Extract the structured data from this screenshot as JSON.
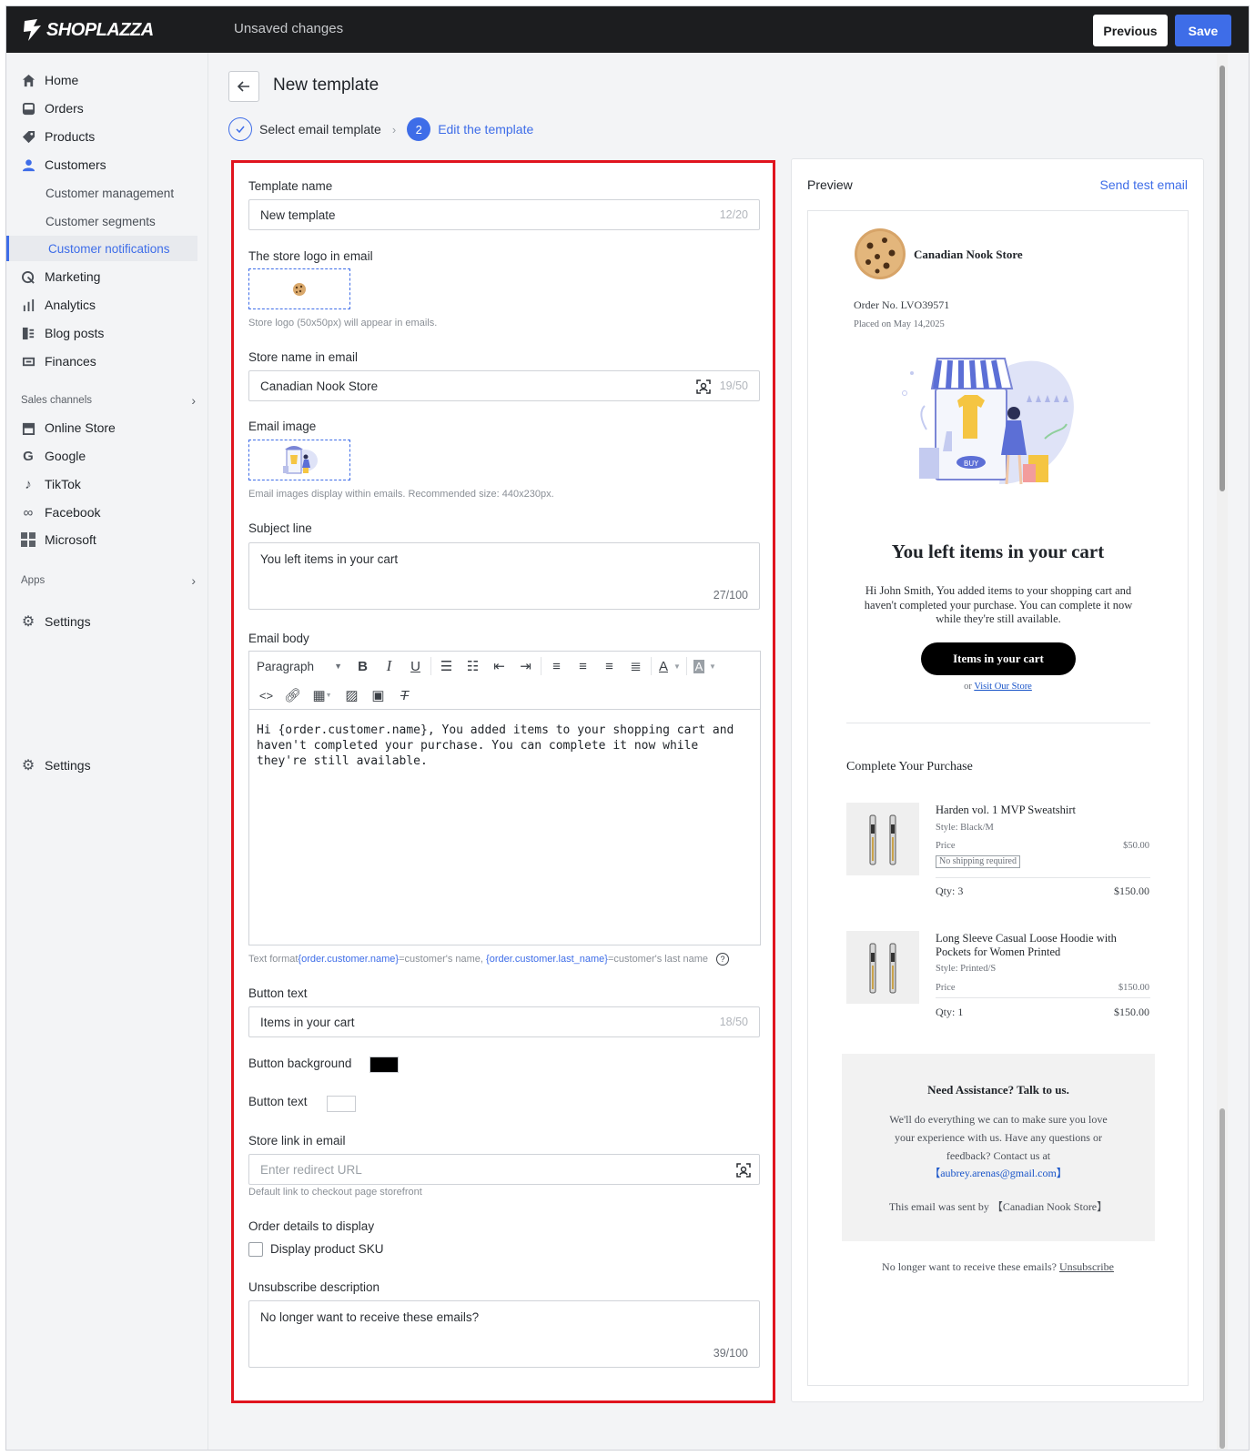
{
  "app": {
    "logo_text": "SHOPLAZZA",
    "status": "Unsaved changes",
    "previous_label": "Previous",
    "save_label": "Save"
  },
  "sidebar": {
    "items": [
      {
        "label": "Home",
        "icon": "home-icon"
      },
      {
        "label": "Orders",
        "icon": "orders-icon"
      },
      {
        "label": "Products",
        "icon": "tag-icon"
      },
      {
        "label": "Customers",
        "icon": "person-icon"
      }
    ],
    "customer_sub": [
      "Customer management",
      "Customer segments",
      "Customer notifications"
    ],
    "items2": [
      {
        "label": "Marketing",
        "icon": "marketing-icon"
      },
      {
        "label": "Analytics",
        "icon": "analytics-icon"
      },
      {
        "label": "Blog posts",
        "icon": "blog-icon"
      },
      {
        "label": "Finances",
        "icon": "finances-icon"
      }
    ],
    "sales_channels_label": "Sales channels",
    "channels": [
      "Online Store",
      "Google",
      "TikTok",
      "Facebook",
      "Microsoft"
    ],
    "apps_label": "Apps",
    "settings_label": "Settings",
    "settings_label2": "Settings"
  },
  "page": {
    "title": "New template",
    "step1": "Select email template",
    "step2_num": "2",
    "step2": "Edit the template"
  },
  "form": {
    "template_name_label": "Template name",
    "template_name_value": "New template",
    "template_name_count": "12/20",
    "logo_label": "The store logo in email",
    "logo_hint": "Store logo (50x50px) will appear in emails.",
    "store_name_label": "Store name in email",
    "store_name_value": "Canadian Nook Store",
    "store_name_count": "19/50",
    "email_image_label": "Email image",
    "email_image_hint": "Email images display within emails. Recommended size: 440x230px.",
    "subject_label": "Subject line",
    "subject_value": "You left items in your cart",
    "subject_count": "27/100",
    "body_label": "Email body",
    "paragraph_select": "Paragraph",
    "body_value": "Hi {order.customer.name}, You added items to your shopping cart and haven't completed your purchase. You can complete it now while they're still available.",
    "format_prefix": "Text format",
    "format_var1": "{order.customer.name}",
    "format_mid": "=customer's name, ",
    "format_var2": "{order.customer.last_name}",
    "format_suffix": "=customer's last name",
    "button_text_label": "Button text",
    "button_text_value": "Items in your cart",
    "button_text_count": "18/50",
    "button_bg_label": "Button background",
    "button_bg_color": "#000000",
    "button_text_color_label": "Button text",
    "button_text_color": "#ffffff",
    "store_link_label": "Store link in email",
    "store_link_placeholder": "Enter redirect URL",
    "store_link_hint": "Default link to checkout page storefront",
    "order_details_label": "Order details to display",
    "sku_label": "Display product SKU",
    "unsub_label": "Unsubscribe description",
    "unsub_value": "No longer want to receive these emails?",
    "unsub_count": "39/100"
  },
  "preview": {
    "title": "Preview",
    "send_test": "Send test email",
    "store_name": "Canadian Nook Store",
    "order_no": "Order No. LVO39571",
    "placed_on": "Placed on May 14,2025",
    "illustration_buy": "BUY",
    "headline": "You left items in your cart",
    "body": "Hi John Smith, You added items to your shopping cart and haven't completed your purchase. You can complete it now while they're still available.",
    "button": "Items in your cart",
    "or_text": "or",
    "visit_store": "Visit Our Store",
    "complete_title": "Complete Your Purchase",
    "products": [
      {
        "name": "Harden vol. 1 MVP Sweatshirt",
        "style": "Style: Black/M",
        "price_label": "Price",
        "price": "$50.00",
        "note": "No shipping required",
        "qty": "Qty: 3",
        "total": "$150.00"
      },
      {
        "name": "Long Sleeve Casual Loose Hoodie with Pockets for Women Printed",
        "style": "Style: Printed/S",
        "price_label": "Price",
        "price": "$150.00",
        "qty": "Qty: 1",
        "total": "$150.00"
      }
    ],
    "assist_title": "Need Assistance? Talk to us.",
    "assist_body": "We'll do everything we can to make sure you love your experience with us. Have any questions or feedback? Contact us at",
    "assist_email": "【aubrey.arenas@gmail.com】",
    "sent_by": "This email was sent by 【Canadian Nook Store】",
    "unsub_text": "No longer want to receive these emails?",
    "unsub_link": "Unsubscribe"
  }
}
